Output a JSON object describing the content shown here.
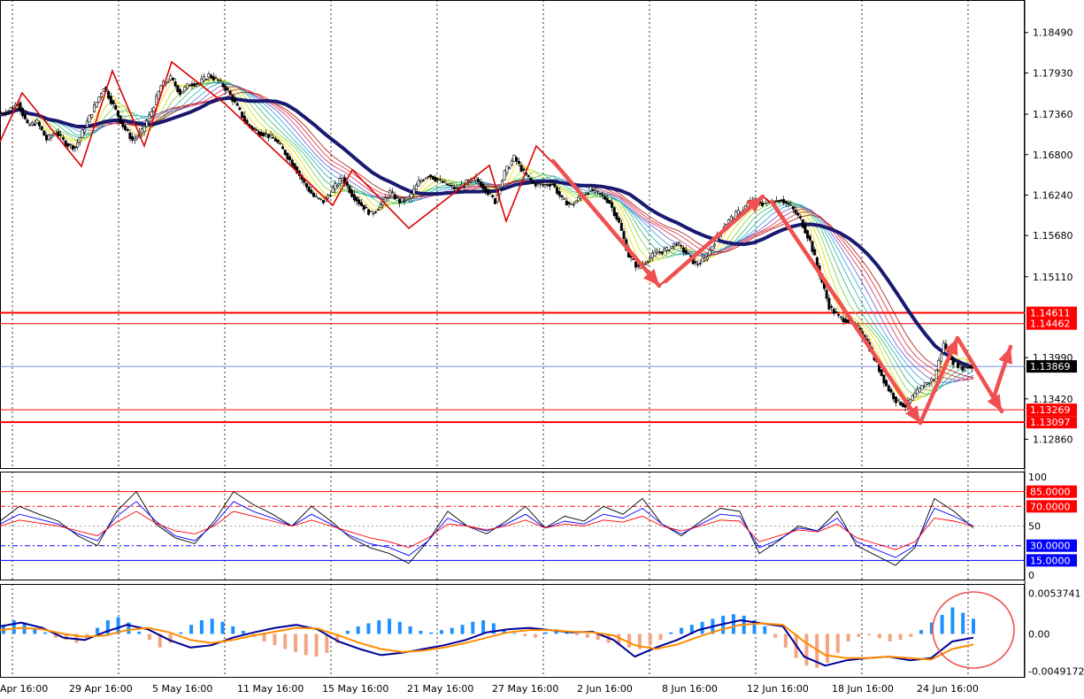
{
  "chart_data": [
    {
      "type": "candlestick",
      "price_axis_ticks": [
        "1.18490",
        "1.17930",
        "1.17360",
        "1.16800",
        "1.16240",
        "1.15680",
        "1.15110",
        "1.13990",
        "1.13420",
        "1.12860"
      ],
      "tick_values": [
        1.1849,
        1.1793,
        1.1736,
        1.168,
        1.1624,
        1.1568,
        1.1511,
        1.1399,
        1.1342,
        1.1286
      ],
      "ylim": [
        1.1245,
        1.1894
      ],
      "current_price": {
        "label": "1.13869",
        "value": 1.13869,
        "color": "#000000"
      },
      "levels": [
        {
          "label": "1.14611",
          "value": 1.14611,
          "color": "#ff0000"
        },
        {
          "label": "1.14462",
          "value": 1.14462,
          "color": "#ff0000"
        },
        {
          "label": "1.13269",
          "value": 1.13269,
          "color": "#ff0000"
        },
        {
          "label": "1.13097",
          "value": 1.13097,
          "color": "#ff0000"
        }
      ],
      "price_path": [
        1.1735,
        1.1741,
        1.1752,
        1.172,
        1.1725,
        1.1701,
        1.1712,
        1.1695,
        1.169,
        1.1718,
        1.1746,
        1.1774,
        1.1748,
        1.172,
        1.17,
        1.1712,
        1.174,
        1.1775,
        1.1786,
        1.1765,
        1.1778,
        1.1779,
        1.179,
        1.1782,
        1.1768,
        1.1745,
        1.1722,
        1.1712,
        1.1708,
        1.17,
        1.1682,
        1.1663,
        1.164,
        1.1622,
        1.1615,
        1.1632,
        1.1648,
        1.1625,
        1.161,
        1.1598,
        1.161,
        1.1628,
        1.1615,
        1.162,
        1.1642,
        1.1652,
        1.1645,
        1.1638,
        1.1632,
        1.1641,
        1.1646,
        1.1632,
        1.1615,
        1.1655,
        1.1676,
        1.1655,
        1.164,
        1.1638,
        1.164,
        1.1618,
        1.161,
        1.1622,
        1.1632,
        1.1625,
        1.1614,
        1.1585,
        1.154,
        1.1523,
        1.1535,
        1.1545,
        1.1548,
        1.1558,
        1.1544,
        1.1528,
        1.1535,
        1.156,
        1.1582,
        1.1595,
        1.1605,
        1.1618,
        1.1612,
        1.1615,
        1.1618,
        1.1608,
        1.159,
        1.156,
        1.1515,
        1.147,
        1.1455,
        1.145,
        1.144,
        1.142,
        1.139,
        1.136,
        1.134,
        1.1332,
        1.1348,
        1.1362,
        1.137,
        1.1418,
        1.1393,
        1.1385,
        1.1387
      ],
      "x_start": 0,
      "x_end": 1100
    },
    {
      "type": "line",
      "title": "",
      "y_axis_ticks": [
        "100",
        "50",
        "0"
      ],
      "levels": [
        {
          "label": "85.0000",
          "value": 85,
          "color": "#ff0000"
        },
        {
          "label": "70.0000",
          "value": 70,
          "color": "#ff0000"
        },
        {
          "label": "30.0000",
          "value": 30,
          "color": "#0000ff"
        },
        {
          "label": "15.0000",
          "value": 15,
          "color": "#0000ff"
        }
      ],
      "ylim": [
        0,
        100
      ],
      "series": [
        {
          "color": "#000000",
          "values": [
            55,
            70,
            62,
            55,
            40,
            30,
            65,
            85,
            52,
            38,
            32,
            55,
            85,
            72,
            62,
            50,
            70,
            55,
            38,
            28,
            22,
            12,
            35,
            65,
            50,
            42,
            55,
            70,
            48,
            60,
            55,
            70,
            62,
            78,
            52,
            40,
            55,
            68,
            65,
            22,
            35,
            50,
            45,
            65,
            30,
            20,
            10,
            28,
            78,
            65,
            48
          ]
        },
        {
          "color": "#0000ff",
          "values": [
            52,
            62,
            57,
            52,
            42,
            35,
            60,
            75,
            55,
            40,
            35,
            52,
            75,
            65,
            58,
            50,
            62,
            52,
            40,
            32,
            28,
            20,
            35,
            58,
            50,
            45,
            52,
            62,
            48,
            55,
            52,
            62,
            58,
            68,
            52,
            42,
            52,
            62,
            60,
            28,
            36,
            48,
            45,
            58,
            34,
            26,
            18,
            30,
            68,
            60,
            50
          ]
        },
        {
          "color": "#ff0000",
          "values": [
            50,
            56,
            53,
            50,
            45,
            40,
            54,
            65,
            53,
            45,
            42,
            50,
            65,
            60,
            55,
            50,
            56,
            50,
            44,
            38,
            34,
            28,
            38,
            52,
            50,
            46,
            50,
            56,
            48,
            52,
            50,
            56,
            54,
            60,
            50,
            45,
            50,
            56,
            55,
            34,
            40,
            46,
            44,
            52,
            38,
            32,
            26,
            34,
            58,
            55,
            50
          ]
        }
      ]
    },
    {
      "type": "bar",
      "title": "",
      "y_axis_ticks": [
        "0.0053741",
        "0.00",
        "-0.0049172"
      ],
      "tick_values": [
        0.0053741,
        0,
        -0.0049172
      ],
      "ylim": [
        -0.0058,
        0.0066
      ],
      "histogram": [
        0.0012,
        0.0018,
        0.0015,
        0.0008,
        0.0002,
        -0.0005,
        -0.0008,
        -0.0012,
        -0.0005,
        0.0008,
        0.0018,
        0.0022,
        0.0015,
        0.0003,
        -0.0008,
        -0.0018,
        -0.0012,
        0.0002,
        0.0012,
        0.0018,
        0.002,
        0.0016,
        0.001,
        0.0004,
        -0.0004,
        -0.001,
        -0.0015,
        -0.002,
        -0.0024,
        -0.0028,
        -0.003,
        -0.0025,
        -0.0012,
        0.0004,
        0.001,
        0.0014,
        0.0018,
        0.002,
        0.0016,
        0.001,
        0.0004,
        0.0002,
        0.0005,
        0.0008,
        0.0012,
        0.0016,
        0.0018,
        0.0014,
        0.0006,
        0.0001,
        -0.0003,
        -0.0005,
        0.0002,
        0.0006,
        0.0004,
        -0.0002,
        -0.0005,
        -0.0008,
        -0.0012,
        -0.0015,
        -0.0018,
        -0.002,
        -0.0015,
        -0.0008,
        0.0002,
        0.0008,
        0.0012,
        0.0016,
        0.002,
        0.0024,
        0.0026,
        0.0024,
        0.0018,
        0.001,
        -0.0005,
        -0.0018,
        -0.0032,
        -0.0042,
        -0.0045,
        -0.0038,
        -0.0025,
        -0.001,
        -0.0004,
        -0.0002,
        -0.0006,
        -0.001,
        -0.0008,
        -0.0004,
        0.0005,
        0.0015,
        0.0025,
        0.0035,
        0.0028,
        0.002
      ],
      "series": [
        {
          "color": "#000099",
          "values": [
            0.001,
            0.0015,
            0.0008,
            -0.0005,
            -0.0008,
            0.0003,
            0.0012,
            0.0006,
            -0.0008,
            -0.0018,
            -0.0015,
            -0.0005,
            0.0002,
            0.0008,
            0.0012,
            0.0006,
            -0.001,
            -0.002,
            -0.0028,
            -0.0025,
            -0.002,
            -0.0015,
            -0.0008,
            0.0002,
            0.0006,
            0.0008,
            0.0005,
            0.0002,
            0.0003,
            -0.0008,
            -0.003,
            -0.0018,
            -0.0008,
            0.0005,
            0.0012,
            0.0018,
            0.0014,
            0.001,
            -0.003,
            -0.0042,
            -0.0035,
            -0.0032,
            -0.003,
            -0.0035,
            -0.0032,
            -0.001,
            -0.0005
          ]
        },
        {
          "color": "#ff8c00",
          "values": [
            0.0005,
            0.0008,
            0.0006,
            0.0,
            -0.0004,
            -0.0002,
            0.0005,
            0.0008,
            0.0002,
            -0.0008,
            -0.0012,
            -0.0008,
            -0.0002,
            0.0003,
            0.0008,
            0.0007,
            -0.0002,
            -0.0012,
            -0.002,
            -0.0024,
            -0.0022,
            -0.0018,
            -0.0012,
            -0.0005,
            0.0002,
            0.0005,
            0.0005,
            0.0003,
            0.0002,
            -0.0002,
            -0.0015,
            -0.002,
            -0.0014,
            -0.0004,
            0.0005,
            0.0012,
            0.0014,
            0.0012,
            -0.001,
            -0.0028,
            -0.0032,
            -0.0032,
            -0.003,
            -0.0032,
            -0.0034,
            -0.002,
            -0.0014
          ]
        }
      ]
    }
  ],
  "time_axis_labels": [
    "Apr 16:00",
    "29 Apr 16:00",
    "5 May 16:00",
    "11 May 16:00",
    "15 May 16:00",
    "21 May 16:00",
    "27 May 16:00",
    "2 Jun 16:00",
    "8 Jun 16:00",
    "12 Jun 16:00",
    "18 Jun 16:00",
    "24 Jun 16:00"
  ],
  "colors": {
    "ma_slow": "#191970",
    "zigzag": "#dd0000",
    "arrows": "#f05050",
    "hist_up": "#1e90ff",
    "hist_down": "#f4a582",
    "circle": "#f05050"
  }
}
